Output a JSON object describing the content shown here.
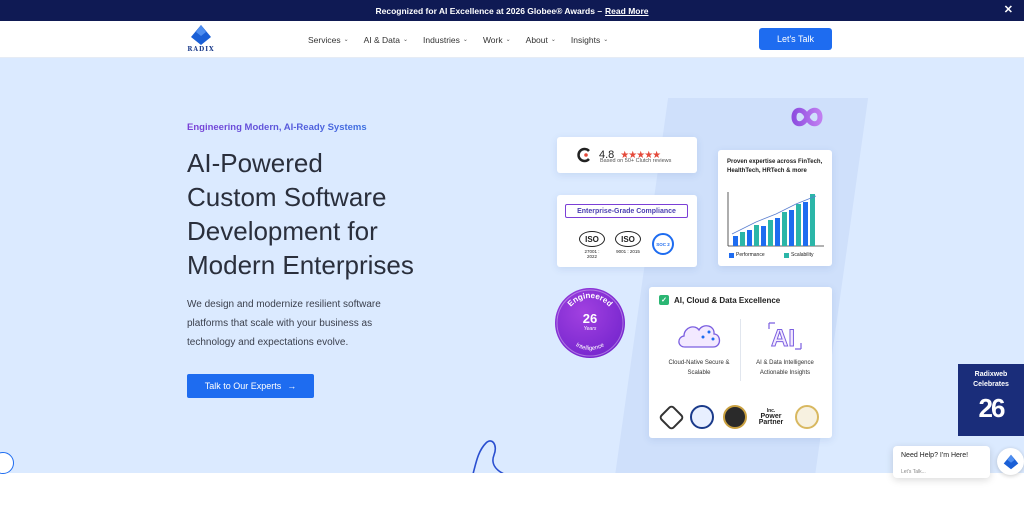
{
  "announcement": {
    "text": "Recognized for AI Excellence at 2026 Globee® Awards –",
    "link": "Read More"
  },
  "header": {
    "logo_text": "RADIX",
    "nav": [
      {
        "label": "Services"
      },
      {
        "label": "AI & Data"
      },
      {
        "label": "Industries"
      },
      {
        "label": "Work"
      },
      {
        "label": "About"
      },
      {
        "label": "Insights"
      }
    ],
    "cta": "Let's Talk"
  },
  "hero": {
    "eyebrow": "Engineering Modern, AI-Ready Systems",
    "headline_lines": [
      "AI-Powered",
      "Custom Software",
      "Development for",
      "Modern Enterprises"
    ],
    "subtext": "We design and modernize resilient software platforms that scale with your business as technology and expectations evolve.",
    "cta": "Talk to Our Experts"
  },
  "rating_card": {
    "score": "4.8",
    "stars": "★★★★★",
    "based_on": "Based on 50+ Clutch reviews"
  },
  "compliance_card": {
    "title": "Enterprise-Grade Compliance",
    "iso1_label": "ISO",
    "iso1_code": "27001 : 2022",
    "iso2_label": "ISO",
    "iso2_code": "9001 : 2015",
    "soc_label": "SOC 2"
  },
  "chart_card": {
    "title": "Proven expertise across FinTech, HealthTech, HRTech & more",
    "legend": [
      {
        "label": "Performance",
        "color": "#1e6cf0"
      },
      {
        "label": "Scalability",
        "color": "#2bb6a8"
      }
    ]
  },
  "years_badge": {
    "top_text": "Engineered",
    "years": "26",
    "years_sub": "Years",
    "bottom_text": "Intelligence"
  },
  "excellence_card": {
    "title": "AI, Cloud & Data Excellence",
    "feature1": [
      "Cloud-Native Secure &",
      "Scalable"
    ],
    "feature2": [
      "AI & Data Intelligence",
      "Actionable Insights"
    ],
    "partner_text": [
      "Inc.",
      "Power",
      "Partner"
    ]
  },
  "promo": {
    "line1": "Radixweb",
    "line2": "Celebrates",
    "number": "26"
  },
  "help": {
    "title": "Need Help? I'm Here!",
    "sub": "Let's Talk..."
  },
  "colors": {
    "primary": "#1e6cf0",
    "navy": "#0f1a54",
    "hero_bg": "#dbeaff",
    "purple": "#7b3fd6"
  }
}
